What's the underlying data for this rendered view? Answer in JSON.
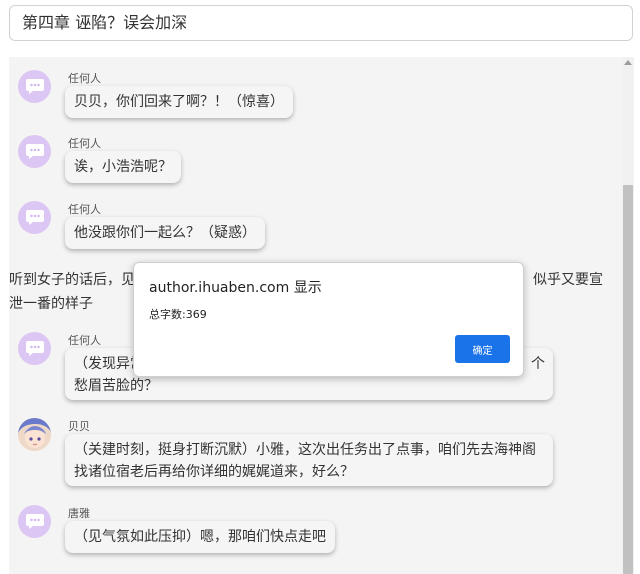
{
  "chapter_title": "第四章 诬陷？误会加深",
  "messages": [
    {
      "name": "任何人",
      "text": "贝贝，你们回来了啊？！（惊喜）",
      "avatar": "chat-bubble-icon"
    },
    {
      "name": "任何人",
      "text": "诶，小浩浩呢？",
      "avatar": "chat-bubble-icon"
    },
    {
      "name": "任何人",
      "text": "他没跟你们一起么？（疑惑）",
      "avatar": "chat-bubble-icon"
    },
    {
      "name": "任何人",
      "text": "（发现异常",
      "text_tail": "个",
      "text_line2": "愁眉苦脸的？",
      "avatar": "chat-bubble-icon"
    },
    {
      "name": "贝贝",
      "text": "（关建时刻，挺身打断沉默）小雅，这次出任务出了点事，咱们先去海神阁找诸位宿老后再给你详细的娓娓道来，好么？",
      "avatar": "anime-avatar"
    },
    {
      "name": "唐雅",
      "text": "（见气氛如此压抑）嗯，那咱们快点走吧",
      "avatar": "chat-bubble-icon"
    }
  ],
  "narration": {
    "left": "听到女子的话后，见",
    "right": "似乎又要宣",
    "line2": "泄一番的样子"
  },
  "dialog": {
    "title": "author.ihuaben.com 显示",
    "message": "总字数:369",
    "ok_label": "确定"
  },
  "colors": {
    "avatar_bg": "#dcc6f3",
    "button": "#1a73e8",
    "chat_bg": "#f4f4f4"
  }
}
